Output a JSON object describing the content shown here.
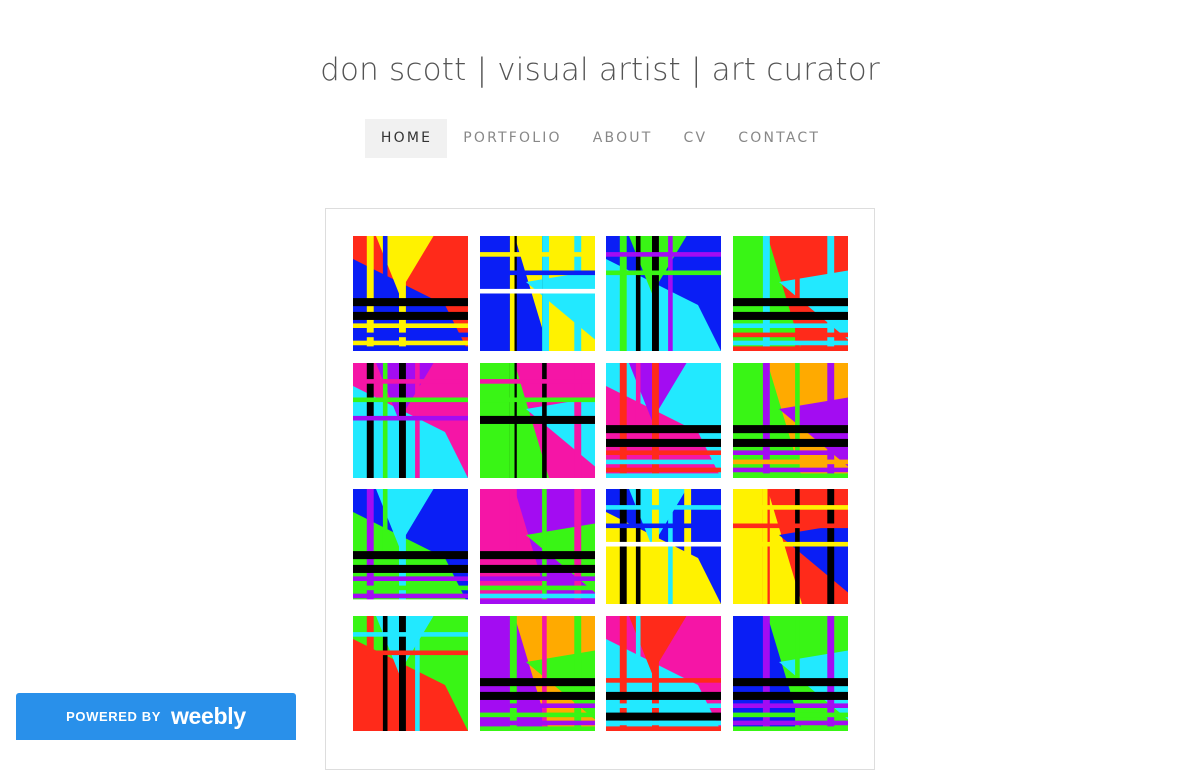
{
  "site": {
    "title": "don scott | visual artist | art curator"
  },
  "nav": {
    "items": [
      {
        "label": "HOME",
        "active": true
      },
      {
        "label": "PORTFOLIO",
        "active": false
      },
      {
        "label": "ABOUT",
        "active": false
      },
      {
        "label": "CV",
        "active": false
      },
      {
        "label": "CONTACT",
        "active": false
      }
    ]
  },
  "artwork": {
    "colors": {
      "red": "#ff2a1a",
      "blue": "#0a1ef5",
      "yellow": "#fff200",
      "black": "#000000",
      "cyan": "#22e9ff",
      "green": "#39f515",
      "purple": "#a30cf2",
      "magenta": "#f515a6",
      "orange": "#ffaa00",
      "white": "#ffffff"
    },
    "tiles": [
      {
        "bg": "red",
        "tri": [
          "blue",
          "yellow"
        ],
        "v": [
          "yellow",
          "blue",
          "yellow"
        ],
        "h": [
          "black",
          "black",
          "yellow",
          "blue",
          "yellow",
          "blue"
        ]
      },
      {
        "bg": "blue",
        "tri": [
          "yellow",
          "cyan"
        ],
        "v": [
          "black",
          "black",
          "cyan",
          "yellow",
          "cyan"
        ],
        "h": [
          "yellow",
          "blue",
          "white"
        ]
      },
      {
        "bg": "blue",
        "tri": [
          "cyan",
          "green"
        ],
        "v": [
          "green",
          "black",
          "black",
          "purple"
        ],
        "h": [
          "purple",
          "green"
        ]
      },
      {
        "bg": "green",
        "tri": [
          "red",
          "cyan"
        ],
        "v": [
          "cyan",
          "red",
          "cyan"
        ],
        "h": [
          "black",
          "black",
          "cyan",
          "red",
          "cyan",
          "red"
        ]
      },
      {
        "bg": "magenta",
        "tri": [
          "cyan",
          "purple"
        ],
        "v": [
          "black",
          "green",
          "black",
          "magenta"
        ],
        "h": [
          "magenta",
          "green",
          "purple"
        ]
      },
      {
        "bg": "green",
        "tri": [
          "magenta",
          "cyan"
        ],
        "v": [
          "black",
          "black",
          "magenta",
          "green"
        ],
        "h": [
          "magenta",
          "green",
          "black"
        ]
      },
      {
        "bg": "cyan",
        "tri": [
          "magenta",
          "purple"
        ],
        "v": [
          "red",
          "magenta",
          "red"
        ],
        "h": [
          "black",
          "black",
          "red",
          "cyan",
          "red",
          "cyan"
        ]
      },
      {
        "bg": "green",
        "tri": [
          "orange",
          "purple"
        ],
        "v": [
          "purple",
          "green",
          "purple"
        ],
        "h": [
          "black",
          "black",
          "purple",
          "orange",
          "purple",
          "green"
        ]
      },
      {
        "bg": "blue",
        "tri": [
          "green",
          "cyan"
        ],
        "v": [
          "purple",
          "green",
          "cyan"
        ],
        "h": [
          "black",
          "black",
          "purple",
          "green",
          "purple",
          "white"
        ]
      },
      {
        "bg": "magenta",
        "tri": [
          "purple",
          "green"
        ],
        "v": [
          "magenta",
          "green",
          "magenta"
        ],
        "h": [
          "black",
          "black",
          "purple",
          "green",
          "cyan",
          "purple"
        ]
      },
      {
        "bg": "blue",
        "tri": [
          "yellow",
          "cyan"
        ],
        "v": [
          "black",
          "black",
          "yellow",
          "cyan",
          "yellow"
        ],
        "h": [
          "cyan",
          "blue",
          "white"
        ]
      },
      {
        "bg": "yellow",
        "tri": [
          "red",
          "blue"
        ],
        "v": [
          "red",
          "black",
          "black",
          "yellow"
        ],
        "h": [
          "yellow",
          "red",
          "yellow"
        ]
      },
      {
        "bg": "green",
        "tri": [
          "red",
          "cyan"
        ],
        "v": [
          "red",
          "black",
          "black",
          "cyan"
        ],
        "h": [
          "cyan",
          "red"
        ]
      },
      {
        "bg": "purple",
        "tri": [
          "orange",
          "green"
        ],
        "v": [
          "green",
          "magenta",
          "green"
        ],
        "h": [
          "black",
          "black",
          "purple",
          "green",
          "purple",
          "green"
        ]
      },
      {
        "bg": "magenta",
        "tri": [
          "cyan",
          "red"
        ],
        "v": [
          "red",
          "cyan",
          "red"
        ],
        "h": [
          "red",
          "black",
          "cyan",
          "black",
          "cyan",
          "red"
        ]
      },
      {
        "bg": "blue",
        "tri": [
          "green",
          "cyan"
        ],
        "v": [
          "purple",
          "green",
          "purple"
        ],
        "h": [
          "black",
          "black",
          "purple",
          "green",
          "purple",
          "green"
        ]
      }
    ]
  },
  "footer": {
    "powered_label": "POWERED BY",
    "brand": "weebly"
  }
}
